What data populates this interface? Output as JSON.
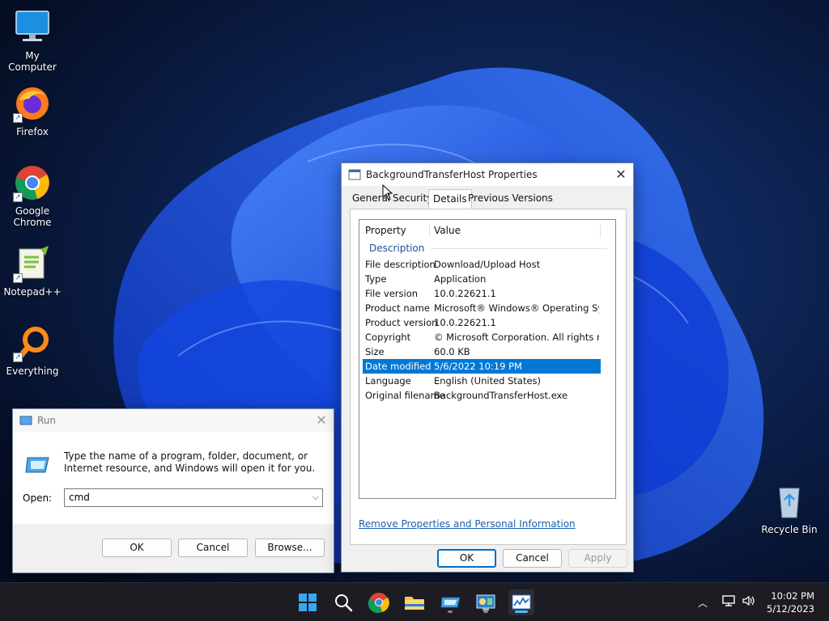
{
  "desktop": {
    "icons": [
      {
        "label": "My Computer"
      },
      {
        "label": "Firefox"
      },
      {
        "label": "Google Chrome"
      },
      {
        "label": "Notepad++"
      },
      {
        "label": "Everything"
      },
      {
        "label": "Recycle Bin"
      }
    ]
  },
  "properties_dialog": {
    "title": "BackgroundTransferHost Properties",
    "tabs": [
      "General",
      "Security",
      "Details",
      "Previous Versions"
    ],
    "active_tab": "Details",
    "list": {
      "headers": {
        "property": "Property",
        "value": "Value"
      },
      "group": "Description",
      "rows": [
        {
          "property": "File description",
          "value": "Download/Upload Host"
        },
        {
          "property": "Type",
          "value": "Application"
        },
        {
          "property": "File version",
          "value": "10.0.22621.1"
        },
        {
          "property": "Product name",
          "value": "Microsoft® Windows® Operating System"
        },
        {
          "property": "Product version",
          "value": "10.0.22621.1"
        },
        {
          "property": "Copyright",
          "value": "© Microsoft Corporation. All rights reserv..."
        },
        {
          "property": "Size",
          "value": "60.0 KB"
        },
        {
          "property": "Date modified",
          "value": "5/6/2022 10:19 PM"
        },
        {
          "property": "Language",
          "value": "English (United States)"
        },
        {
          "property": "Original filename",
          "value": "BackgroundTransferHost.exe"
        }
      ],
      "selected_row": "Date modified"
    },
    "remove_link": "Remove Properties and Personal Information",
    "buttons": {
      "ok": "OK",
      "cancel": "Cancel",
      "apply": "Apply"
    }
  },
  "run_dialog": {
    "title": "Run",
    "description": "Type the name of a program, folder, document, or Internet resource, and Windows will open it for you.",
    "open_label": "Open:",
    "input_value": "cmd",
    "buttons": {
      "ok": "OK",
      "cancel": "Cancel",
      "browse": "Browse..."
    }
  },
  "taskbar": {
    "apps": [
      "start-icon",
      "search-icon",
      "chrome-icon",
      "file-explorer-icon",
      "run-icon",
      "control-panel-icon",
      "monitor-app-icon"
    ],
    "clock_time": "10:02 PM",
    "clock_date": "5/12/2023"
  },
  "colors": {
    "accent": "#0078d4",
    "selection": "#0078d4",
    "taskbar": "#1c1c22"
  }
}
